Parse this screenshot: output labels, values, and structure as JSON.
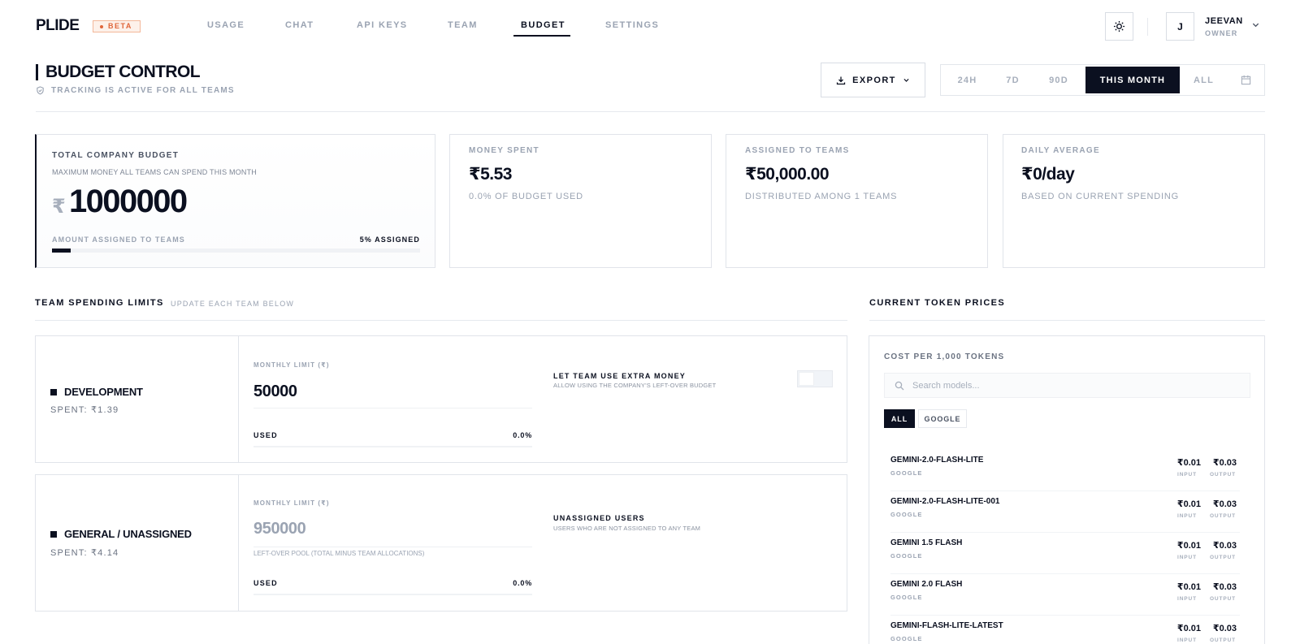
{
  "app": {
    "logo": "PLIDE",
    "beta": "BETA"
  },
  "nav": [
    {
      "label": "USAGE"
    },
    {
      "label": "CHAT"
    },
    {
      "label": "API KEYS"
    },
    {
      "label": "TEAM"
    },
    {
      "label": "BUDGET",
      "active": true
    },
    {
      "label": "SETTINGS"
    }
  ],
  "user": {
    "initial": "J",
    "name": "JEEVAN",
    "role": "OWNER"
  },
  "page": {
    "title": "BUDGET CONTROL",
    "status": "TRACKING IS ACTIVE FOR ALL TEAMS",
    "export_label": "EXPORT",
    "ranges": [
      "24H",
      "7D",
      "90D",
      "THIS MONTH",
      "ALL"
    ],
    "active_range": "THIS MONTH"
  },
  "stats": {
    "total_budget": {
      "label": "TOTAL COMPANY BUDGET",
      "desc": "MAXIMUM MONEY ALL TEAMS CAN SPEND THIS MONTH",
      "currency": "₹",
      "amount": "1000000",
      "assigned_label": "AMOUNT ASSIGNED TO TEAMS",
      "assigned_pct": "5% ASSIGNED",
      "assigned_fraction": 0.05
    },
    "money_spent": {
      "label": "MONEY SPENT",
      "value": "₹5.53",
      "sub": "0.0% OF BUDGET USED"
    },
    "assigned": {
      "label": "ASSIGNED TO TEAMS",
      "value": "₹50,000.00",
      "sub": "DISTRIBUTED AMONG 1 TEAMS"
    },
    "daily": {
      "label": "DAILY AVERAGE",
      "value": "₹0/day",
      "sub": "BASED ON CURRENT SPENDING"
    }
  },
  "teams_section": {
    "title": "TEAM SPENDING LIMITS",
    "sub": "UPDATE EACH TEAM BELOW"
  },
  "teams": [
    {
      "name": "DEVELOPMENT",
      "spent": "SPENT: ₹1.39",
      "limit_label": "MONTHLY LIMIT (₹)",
      "limit": "50000",
      "used_label": "USED",
      "used_pct": "0.0%",
      "option_title": "LET TEAM USE EXTRA MONEY",
      "option_desc": "ALLOW USING THE COMPANY'S LEFT-OVER BUDGET",
      "toggle_on": false
    },
    {
      "name": "GENERAL / UNASSIGNED",
      "spent": "SPENT: ₹4.14",
      "limit_label": "MONTHLY LIMIT (₹)",
      "limit": "950000",
      "pool_note": "LEFT-OVER POOL (TOTAL MINUS TEAM ALLOCATIONS)",
      "used_label": "USED",
      "used_pct": "0.0%",
      "option_title": "UNASSIGNED USERS",
      "option_desc": "USERS WHO ARE NOT ASSIGNED TO ANY TEAM"
    }
  ],
  "prices": {
    "title": "CURRENT TOKEN PRICES",
    "label": "COST PER 1,000 TOKENS",
    "search_placeholder": "Search models...",
    "filters": [
      "ALL",
      "GOOGLE"
    ],
    "input_tag": "INPUT",
    "output_tag": "OUTPUT",
    "models": [
      {
        "name": "GEMINI-2.0-FLASH-LITE",
        "provider": "GOOGLE",
        "input": "₹0.01",
        "output": "₹0.03"
      },
      {
        "name": "GEMINI-2.0-FLASH-LITE-001",
        "provider": "GOOGLE",
        "input": "₹0.01",
        "output": "₹0.03"
      },
      {
        "name": "GEMINI 1.5 FLASH",
        "provider": "GOOGLE",
        "input": "₹0.01",
        "output": "₹0.03"
      },
      {
        "name": "GEMINI 2.0 FLASH",
        "provider": "GOOGLE",
        "input": "₹0.01",
        "output": "₹0.03"
      },
      {
        "name": "GEMINI-FLASH-LITE-LATEST",
        "provider": "GOOGLE",
        "input": "₹0.01",
        "output": "₹0.03"
      }
    ]
  },
  "icons": {
    "theme": "sun-icon",
    "user_menu": "chevron-down-icon",
    "status": "shield-check-icon",
    "export": "download-icon",
    "calendar": "calendar-icon",
    "search": "search-icon"
  }
}
